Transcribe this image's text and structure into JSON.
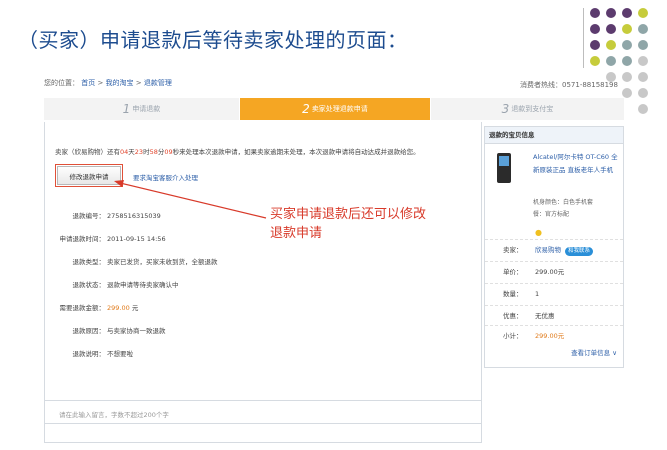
{
  "slide": {
    "title": "（买家）申请退款后等待卖家处理的页面："
  },
  "decor": {
    "dot_colors": [
      "#5c3b6e",
      "#c6cc3b",
      "#8fa6a8",
      "#c8c8c8"
    ]
  },
  "breadcrumb": {
    "prefix": "您的位置：",
    "items": [
      "首页",
      "我的淘宝",
      "退款管理"
    ],
    "sep": " > "
  },
  "hotline": "消费者热线：0571-88158198",
  "steps": [
    {
      "num": "1",
      "label": "申请退款",
      "active": false
    },
    {
      "num": "2",
      "label": "卖家处理退款申请",
      "active": true
    },
    {
      "num": "3",
      "label": "退款到支付宝",
      "active": false
    }
  ],
  "notice": {
    "before": "卖家（",
    "seller": "欣易购物",
    "mid": "）还有",
    "days": "04",
    "d_unit": "天",
    "hours": "23",
    "h_unit": "时",
    "mins": "58",
    "m_unit": "分",
    "secs": "09",
    "s_unit": "秒",
    "after": "来处理本次退款申请，如果卖家逾期未处理，本次退款申请将自动达成并退款给您。"
  },
  "buttons": {
    "modify": "修改退款申请",
    "service": "要求淘宝客服介入处理"
  },
  "fields": [
    {
      "label": "退款编号：",
      "value": "2758516315039"
    },
    {
      "label": "申请退款时间：",
      "value": "2011-09-15  14:56"
    },
    {
      "label": "退款类型：",
      "value": "卖家已发货，买家未收到货，全额退款"
    },
    {
      "label": "退款状态：",
      "value": "退款申请等待卖家确认中"
    },
    {
      "label": "需要退款金额：",
      "value": "299.00",
      "unit": " 元"
    },
    {
      "label": "退款原因：",
      "value": "与卖家协商一致退款"
    },
    {
      "label": "退款说明：",
      "value": "不想要啦"
    }
  ],
  "annotation": {
    "line1": "买家申请退款后还可以修改",
    "line2": "退款申请"
  },
  "message": {
    "placeholder": "请在此输入留言，字数不超过200个字"
  },
  "side": {
    "header": "退款的宝贝信息",
    "product_name": "Alcatel/阿尔卡特 OT-C60 全新原装正品 直板老年人手机",
    "meta1": "机身颜色：白色手机套",
    "meta2": "餐：官方标配",
    "rows": [
      {
        "k": "卖家：",
        "v": "欣易购物",
        "contact": "和我联系"
      },
      {
        "k": "单价：",
        "v": "299.00元"
      },
      {
        "k": "数量：",
        "v": "1"
      },
      {
        "k": "优惠：",
        "v": "无优惠"
      },
      {
        "k": "小计：",
        "v": "299.00元"
      }
    ],
    "order_link": "查看订单信息 ∨"
  }
}
